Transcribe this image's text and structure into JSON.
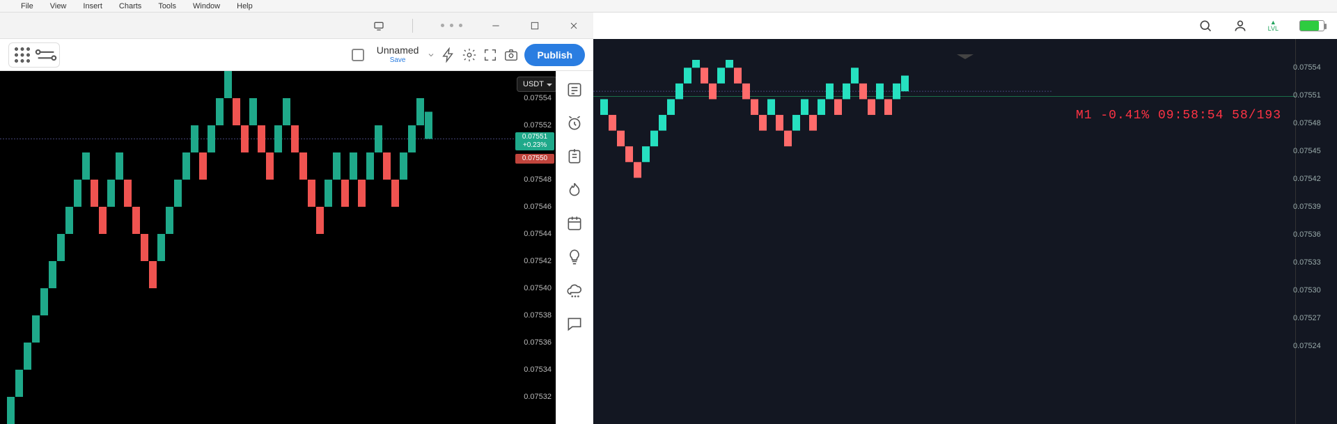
{
  "app_menu": [
    "File",
    "View",
    "Insert",
    "Charts",
    "Tools",
    "Window",
    "Help"
  ],
  "window_controls": {
    "cast": "cast-icon",
    "more": "more-icon",
    "min": "minimize",
    "max": "maximize",
    "close": "close"
  },
  "toolbar": {
    "tools": [
      "grid-icon",
      "trend-line-icon",
      "arrow-icon",
      "shape-icon",
      "line-icon",
      "para-lines-icon",
      "up-arrow-icon",
      "dot-line-icon"
    ],
    "unnamed_label": "Unnamed",
    "save_label": "Save",
    "publish_label": "Publish"
  },
  "left_chart": {
    "currency": "USDT",
    "axis_ticks": [
      "0.07554",
      "0.07552",
      "0.07548",
      "0.07546",
      "0.07544",
      "0.07542",
      "0.07540",
      "0.07538",
      "0.07536",
      "0.07534",
      "0.07532"
    ],
    "last_price": "0.07551",
    "last_change": "+0.23%",
    "prev_price": "0.07550"
  },
  "sidebar": [
    "watchlist-icon",
    "alarm-icon",
    "notes-icon",
    "hot-icon",
    "calendar-icon",
    "idea-icon",
    "cloud-icon",
    "chat-icon"
  ],
  "right_chart": {
    "overlay": "M1 -0.41% 09:58:54 58/193",
    "axis_ticks": [
      "0.07554",
      "0.07551",
      "0.07548",
      "0.07545",
      "0.07542",
      "0.07539",
      "0.07536",
      "0.07533",
      "0.07530",
      "0.07527",
      "0.07524"
    ],
    "last_price": "0.07551"
  },
  "chart_data": [
    {
      "type": "candlestick-renko",
      "name": "left-panel",
      "currency": "USDT",
      "ylim": [
        0.0753,
        0.07556
      ],
      "last": 0.07551,
      "change_pct": 0.23,
      "colors": {
        "up": "#1fa98a",
        "down": "#ef5350"
      },
      "bricks": [
        {
          "i": 0,
          "v": 0.0753,
          "dir": "up"
        },
        {
          "i": 1,
          "v": 0.07532,
          "dir": "up"
        },
        {
          "i": 2,
          "v": 0.07534,
          "dir": "up"
        },
        {
          "i": 3,
          "v": 0.07536,
          "dir": "up"
        },
        {
          "i": 4,
          "v": 0.07538,
          "dir": "up"
        },
        {
          "i": 5,
          "v": 0.0754,
          "dir": "up"
        },
        {
          "i": 6,
          "v": 0.07542,
          "dir": "up"
        },
        {
          "i": 7,
          "v": 0.07544,
          "dir": "up"
        },
        {
          "i": 8,
          "v": 0.07546,
          "dir": "up"
        },
        {
          "i": 9,
          "v": 0.07548,
          "dir": "up"
        },
        {
          "i": 10,
          "v": 0.07546,
          "dir": "down"
        },
        {
          "i": 11,
          "v": 0.07544,
          "dir": "down"
        },
        {
          "i": 12,
          "v": 0.07546,
          "dir": "up"
        },
        {
          "i": 13,
          "v": 0.07548,
          "dir": "up"
        },
        {
          "i": 14,
          "v": 0.07546,
          "dir": "down"
        },
        {
          "i": 15,
          "v": 0.07544,
          "dir": "down"
        },
        {
          "i": 16,
          "v": 0.07542,
          "dir": "down"
        },
        {
          "i": 17,
          "v": 0.0754,
          "dir": "down"
        },
        {
          "i": 18,
          "v": 0.07542,
          "dir": "up"
        },
        {
          "i": 19,
          "v": 0.07544,
          "dir": "up"
        },
        {
          "i": 20,
          "v": 0.07546,
          "dir": "up"
        },
        {
          "i": 21,
          "v": 0.07548,
          "dir": "up"
        },
        {
          "i": 22,
          "v": 0.0755,
          "dir": "up"
        },
        {
          "i": 23,
          "v": 0.07548,
          "dir": "down"
        },
        {
          "i": 24,
          "v": 0.0755,
          "dir": "up"
        },
        {
          "i": 25,
          "v": 0.07552,
          "dir": "up"
        },
        {
          "i": 26,
          "v": 0.07554,
          "dir": "up"
        },
        {
          "i": 27,
          "v": 0.07552,
          "dir": "down"
        },
        {
          "i": 28,
          "v": 0.0755,
          "dir": "down"
        },
        {
          "i": 29,
          "v": 0.07552,
          "dir": "up"
        },
        {
          "i": 30,
          "v": 0.0755,
          "dir": "down"
        },
        {
          "i": 31,
          "v": 0.07548,
          "dir": "down"
        },
        {
          "i": 32,
          "v": 0.0755,
          "dir": "up"
        },
        {
          "i": 33,
          "v": 0.07552,
          "dir": "up"
        },
        {
          "i": 34,
          "v": 0.0755,
          "dir": "down"
        },
        {
          "i": 35,
          "v": 0.07548,
          "dir": "down"
        },
        {
          "i": 36,
          "v": 0.07546,
          "dir": "down"
        },
        {
          "i": 37,
          "v": 0.07544,
          "dir": "down"
        },
        {
          "i": 38,
          "v": 0.07546,
          "dir": "up"
        },
        {
          "i": 39,
          "v": 0.07548,
          "dir": "up"
        },
        {
          "i": 40,
          "v": 0.07546,
          "dir": "down"
        },
        {
          "i": 41,
          "v": 0.07548,
          "dir": "up"
        },
        {
          "i": 42,
          "v": 0.07546,
          "dir": "down"
        },
        {
          "i": 43,
          "v": 0.07548,
          "dir": "up"
        },
        {
          "i": 44,
          "v": 0.0755,
          "dir": "up"
        },
        {
          "i": 45,
          "v": 0.07548,
          "dir": "down"
        },
        {
          "i": 46,
          "v": 0.07546,
          "dir": "down"
        },
        {
          "i": 47,
          "v": 0.07548,
          "dir": "up"
        },
        {
          "i": 48,
          "v": 0.0755,
          "dir": "up"
        },
        {
          "i": 49,
          "v": 0.07552,
          "dir": "up"
        },
        {
          "i": 50,
          "v": 0.07551,
          "dir": "up"
        }
      ]
    },
    {
      "type": "candlestick-renko",
      "name": "right-panel",
      "timeframe": "M1",
      "change_pct": -0.41,
      "clock": "09:58:54",
      "count": "58/193",
      "ylim": [
        0.07524,
        0.07555
      ],
      "last": 0.07551,
      "colors": {
        "up": "#26e0c0",
        "down": "#ff6b6b"
      },
      "bricks": [
        {
          "i": 0,
          "v": 0.07548,
          "dir": "up"
        },
        {
          "i": 1,
          "v": 0.07546,
          "dir": "down"
        },
        {
          "i": 2,
          "v": 0.07544,
          "dir": "down"
        },
        {
          "i": 3,
          "v": 0.07542,
          "dir": "down"
        },
        {
          "i": 4,
          "v": 0.0754,
          "dir": "down"
        },
        {
          "i": 5,
          "v": 0.07542,
          "dir": "up"
        },
        {
          "i": 6,
          "v": 0.07544,
          "dir": "up"
        },
        {
          "i": 7,
          "v": 0.07546,
          "dir": "up"
        },
        {
          "i": 8,
          "v": 0.07548,
          "dir": "up"
        },
        {
          "i": 9,
          "v": 0.0755,
          "dir": "up"
        },
        {
          "i": 10,
          "v": 0.07552,
          "dir": "up"
        },
        {
          "i": 11,
          "v": 0.07554,
          "dir": "up"
        },
        {
          "i": 12,
          "v": 0.07552,
          "dir": "down"
        },
        {
          "i": 13,
          "v": 0.0755,
          "dir": "down"
        },
        {
          "i": 14,
          "v": 0.07552,
          "dir": "up"
        },
        {
          "i": 15,
          "v": 0.07554,
          "dir": "up"
        },
        {
          "i": 16,
          "v": 0.07552,
          "dir": "down"
        },
        {
          "i": 17,
          "v": 0.0755,
          "dir": "down"
        },
        {
          "i": 18,
          "v": 0.07548,
          "dir": "down"
        },
        {
          "i": 19,
          "v": 0.07546,
          "dir": "down"
        },
        {
          "i": 20,
          "v": 0.07548,
          "dir": "up"
        },
        {
          "i": 21,
          "v": 0.07546,
          "dir": "down"
        },
        {
          "i": 22,
          "v": 0.07544,
          "dir": "down"
        },
        {
          "i": 23,
          "v": 0.07546,
          "dir": "up"
        },
        {
          "i": 24,
          "v": 0.07548,
          "dir": "up"
        },
        {
          "i": 25,
          "v": 0.07546,
          "dir": "down"
        },
        {
          "i": 26,
          "v": 0.07548,
          "dir": "up"
        },
        {
          "i": 27,
          "v": 0.0755,
          "dir": "up"
        },
        {
          "i": 28,
          "v": 0.07548,
          "dir": "down"
        },
        {
          "i": 29,
          "v": 0.0755,
          "dir": "up"
        },
        {
          "i": 30,
          "v": 0.07552,
          "dir": "up"
        },
        {
          "i": 31,
          "v": 0.0755,
          "dir": "down"
        },
        {
          "i": 32,
          "v": 0.07548,
          "dir": "down"
        },
        {
          "i": 33,
          "v": 0.0755,
          "dir": "up"
        },
        {
          "i": 34,
          "v": 0.07548,
          "dir": "down"
        },
        {
          "i": 35,
          "v": 0.0755,
          "dir": "up"
        },
        {
          "i": 36,
          "v": 0.07551,
          "dir": "up"
        }
      ]
    }
  ]
}
